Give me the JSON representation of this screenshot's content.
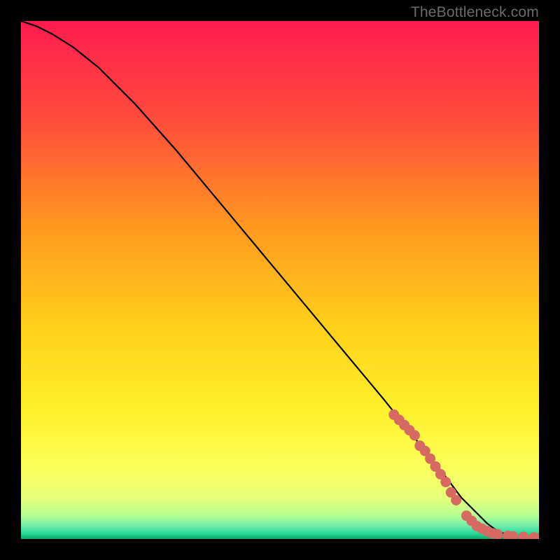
{
  "watermark": "TheBottleneck.com",
  "chart_data": {
    "type": "line",
    "title": "",
    "xlabel": "",
    "ylabel": "",
    "xlim": [
      0,
      100
    ],
    "ylim": [
      0,
      100
    ],
    "grid": false,
    "series": [
      {
        "name": "curve",
        "x": [
          0,
          3,
          6,
          10,
          15,
          22,
          30,
          40,
          50,
          60,
          70,
          78,
          82,
          85,
          88,
          90,
          92,
          94,
          96,
          98,
          100
        ],
        "y": [
          100,
          99,
          97.5,
          95,
          91,
          84,
          75,
          63,
          51,
          39,
          27,
          17,
          12,
          8,
          5,
          3,
          1.5,
          0.8,
          0.4,
          0.2,
          0.1
        ]
      }
    ],
    "points": {
      "name": "data-points",
      "color": "#d66a62",
      "x": [
        72,
        73,
        74,
        75,
        76,
        77,
        78,
        79,
        80,
        81,
        82,
        83,
        84,
        86,
        87,
        88,
        89,
        90,
        91,
        92,
        94,
        95,
        97,
        99,
        100
      ],
      "y": [
        24,
        23,
        22,
        21,
        20,
        18,
        17,
        15.5,
        14,
        12.5,
        11,
        9,
        7.5,
        4.5,
        3.5,
        2.5,
        2,
        1.5,
        1.1,
        0.9,
        0.6,
        0.5,
        0.4,
        0.3,
        0.2
      ]
    },
    "background_gradient_stops": [
      {
        "pos": 0.0,
        "color": "#ff1b50"
      },
      {
        "pos": 0.2,
        "color": "#ff4f3a"
      },
      {
        "pos": 0.4,
        "color": "#ff9a1f"
      },
      {
        "pos": 0.6,
        "color": "#ffd21a"
      },
      {
        "pos": 0.75,
        "color": "#fff02a"
      },
      {
        "pos": 0.86,
        "color": "#fcff5a"
      },
      {
        "pos": 0.92,
        "color": "#e7ff7a"
      },
      {
        "pos": 0.955,
        "color": "#b6ff92"
      },
      {
        "pos": 0.975,
        "color": "#6eedaa"
      },
      {
        "pos": 0.99,
        "color": "#26d79a"
      },
      {
        "pos": 1.0,
        "color": "#0aa760"
      }
    ]
  }
}
